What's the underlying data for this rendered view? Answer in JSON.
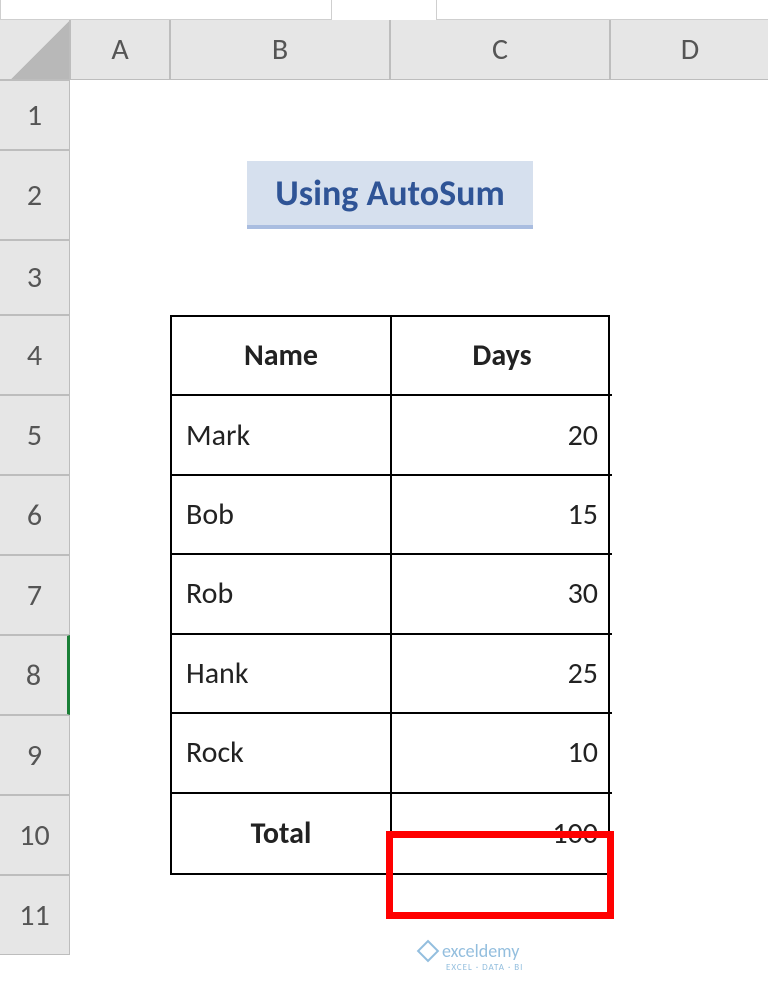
{
  "columns": [
    "A",
    "B",
    "C",
    "D"
  ],
  "rows": [
    "1",
    "2",
    "3",
    "4",
    "5",
    "6",
    "7",
    "8",
    "9",
    "10",
    "11"
  ],
  "active_row": "8",
  "title": "Using AutoSum",
  "table": {
    "headers": [
      "Name",
      "Days"
    ],
    "data": [
      {
        "name": "Mark",
        "days": "20"
      },
      {
        "name": "Bob",
        "days": "15"
      },
      {
        "name": "Rob",
        "days": "30"
      },
      {
        "name": "Hank",
        "days": "25"
      },
      {
        "name": "Rock",
        "days": "10"
      }
    ],
    "total_label": "Total",
    "total_value": "100"
  },
  "highlight_cell": "C10",
  "watermark": {
    "name": "exceldemy",
    "sub": "EXCEL · DATA · BI"
  },
  "chart_data": {
    "type": "table",
    "title": "Using AutoSum",
    "columns": [
      "Name",
      "Days"
    ],
    "rows": [
      [
        "Mark",
        20
      ],
      [
        "Bob",
        15
      ],
      [
        "Rob",
        30
      ],
      [
        "Hank",
        25
      ],
      [
        "Rock",
        10
      ],
      [
        "Total",
        100
      ]
    ]
  }
}
